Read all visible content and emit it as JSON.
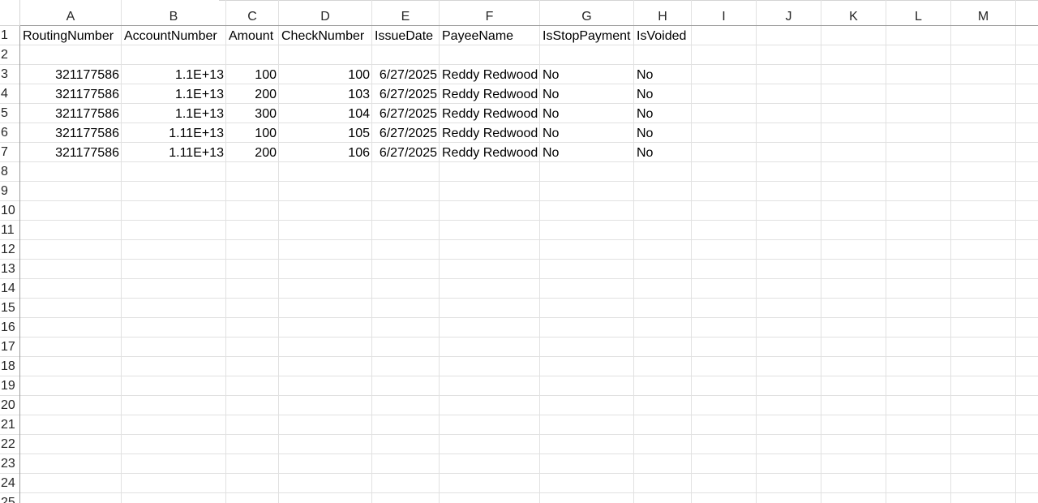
{
  "columns": [
    "A",
    "B",
    "C",
    "D",
    "E",
    "F",
    "G",
    "H",
    "I",
    "J",
    "K",
    "L",
    "M"
  ],
  "row_numbers": [
    "1",
    "2",
    "3",
    "4",
    "5",
    "6",
    "7",
    "8",
    "9",
    "10",
    "11",
    "12",
    "13",
    "14",
    "15",
    "16",
    "17",
    "18",
    "19",
    "20",
    "21",
    "22",
    "23",
    "24",
    "25"
  ],
  "header_row": [
    "RoutingNumber",
    "AccountNumber",
    "Amount",
    "CheckNumber",
    "IssueDate",
    "PayeeName",
    "IsStopPayment",
    "IsVoided"
  ],
  "data_rows": [
    [
      "321177586",
      "1.1E+13",
      "100",
      "100",
      "6/27/2025",
      "Reddy Redwood",
      "No",
      "No"
    ],
    [
      "321177586",
      "1.1E+13",
      "200",
      "103",
      "6/27/2025",
      "Reddy Redwood",
      "No",
      "No"
    ],
    [
      "321177586",
      "1.1E+13",
      "300",
      "104",
      "6/27/2025",
      "Reddy Redwood",
      "No",
      "No"
    ],
    [
      "321177586",
      "1.11E+13",
      "100",
      "105",
      "6/27/2025",
      "Reddy Redwood",
      "No",
      "No"
    ],
    [
      "321177586",
      "1.11E+13",
      "200",
      "106",
      "6/27/2025",
      "Reddy Redwood",
      "No",
      "No"
    ]
  ]
}
